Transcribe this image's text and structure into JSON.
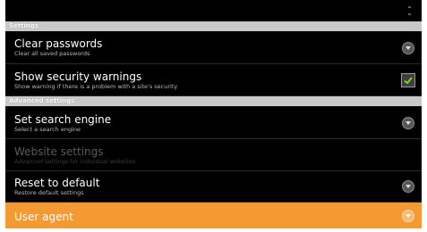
{
  "header": {
    "overflow_icon": "overflow-menu-icon"
  },
  "sections": [
    {
      "label": "Settings",
      "items": [
        {
          "title": "Clear passwords",
          "summary": "Clear all saved passwords",
          "widget": "chevron-icon"
        },
        {
          "title": "Show security warnings",
          "summary": "Show warning if there is a problem with a site's security",
          "widget": "checkbox",
          "checked": true
        }
      ]
    },
    {
      "label": "Advanced settings",
      "items": [
        {
          "title": "Set search engine",
          "summary": "Select a search engine",
          "widget": "chevron-icon"
        },
        {
          "title": "Website settings",
          "summary": "Advanced settings for individual websites",
          "enabled": false
        },
        {
          "title": "Reset to default",
          "summary": "Restore default settings",
          "widget": "chevron-icon"
        },
        {
          "title": "User agent",
          "widget": "chevron-icon",
          "selected": true
        }
      ]
    }
  ],
  "colors": {
    "background": "#000000",
    "section_header": "#c9c9c9",
    "selected_row": "#f39a33",
    "checkmark": "#7ed321"
  }
}
